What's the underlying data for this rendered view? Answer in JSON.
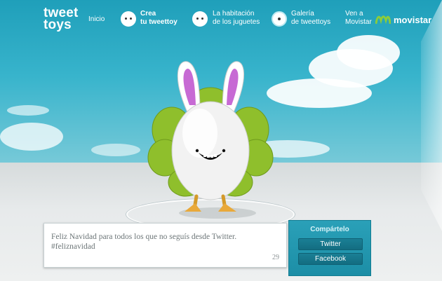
{
  "brand": {
    "logo_line1": "tweet",
    "logo_line2": "toys"
  },
  "nav": {
    "inicio": "Inicio",
    "crea_line1": "Crea",
    "crea_line2": "tu tweettoy",
    "habitacion_line1": "La habitación",
    "habitacion_line2": "de los juguetes",
    "galeria_line1": "Galería",
    "galeria_line2": "de tweettoys",
    "ven_line1": "Ven a",
    "ven_line2": "Movistar",
    "movistar": "movistar"
  },
  "message": {
    "text": "Feliz Navidad para todos los que no seguís desde Twitter.\n#feliznavidad",
    "remaining_chars": "29"
  },
  "share": {
    "title": "Compártelo",
    "twitter_label": "Twitter",
    "facebook_label": "Facebook"
  },
  "colors": {
    "accent": "#1c8ea6",
    "leaf_green": "#8fbf2c",
    "ear_pink": "#c76ad4"
  }
}
